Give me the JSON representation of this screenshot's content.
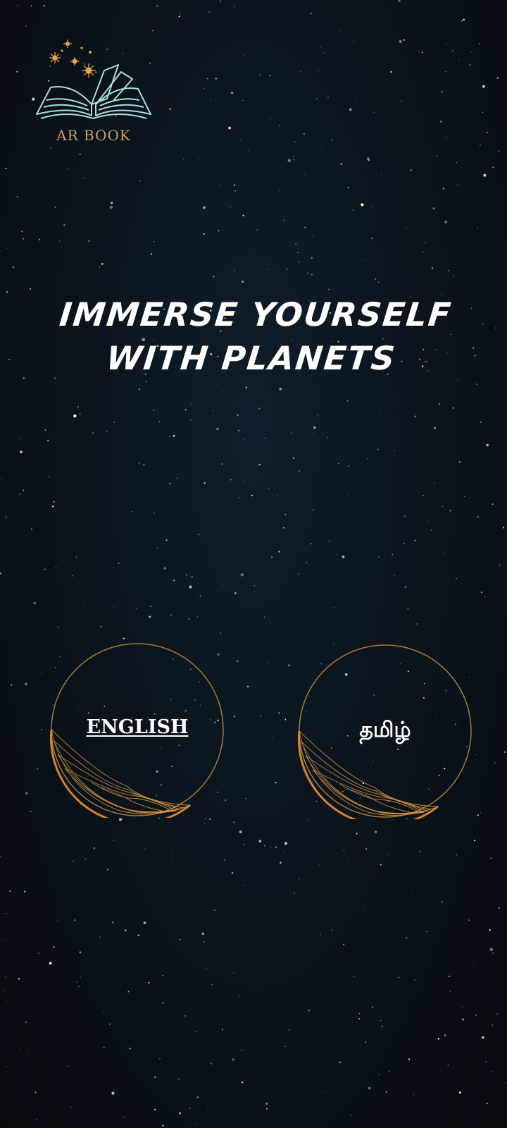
{
  "app": {
    "logo_text": "AR BOOK",
    "logo_icon": "open-book-with-stars-icon"
  },
  "hero": {
    "line1": "IMMERSE YOURSELF",
    "line2": "WITH PLANETS"
  },
  "languages": {
    "english_label": "ENGLISH",
    "tamil_label": "தமிழ்"
  },
  "colors": {
    "background": "#0b141c",
    "accent_gold": "#c9a26a",
    "ring_orange": "#d9842a",
    "text": "#ffffff"
  }
}
